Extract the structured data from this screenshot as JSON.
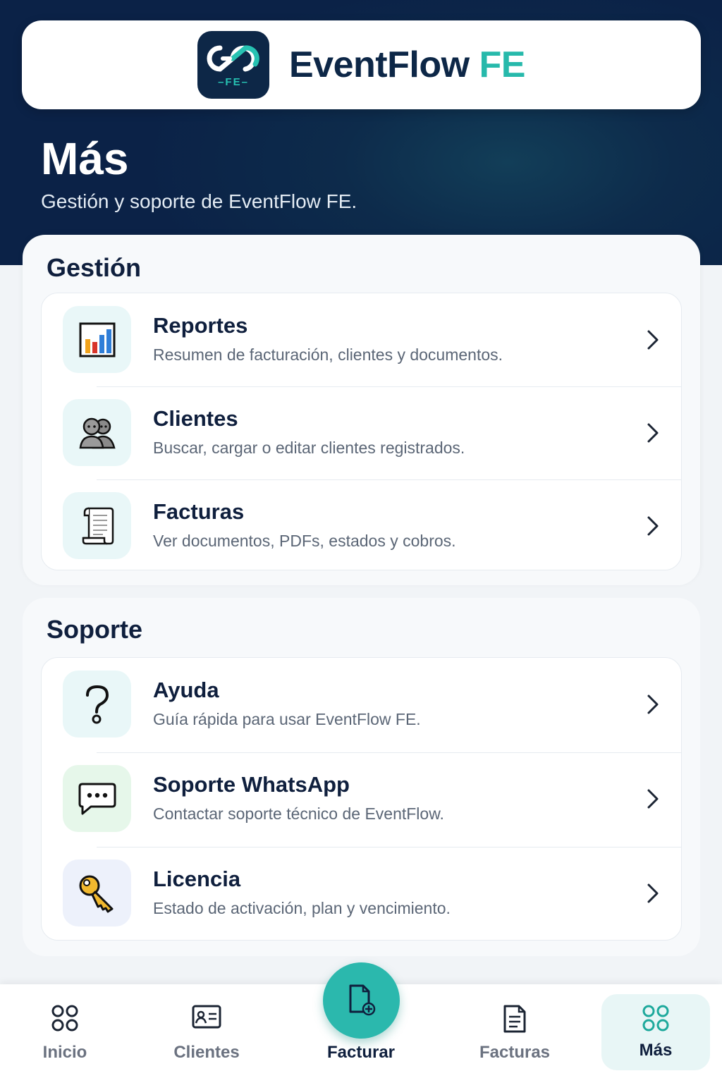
{
  "header": {
    "logo_badge": "FE",
    "brand_name": "EventFlow",
    "brand_accent": "FE"
  },
  "page": {
    "title": "Más",
    "subtitle": "Gestión y soporte de EventFlow FE."
  },
  "sections": {
    "gestion": {
      "title": "Gestión",
      "items": [
        {
          "icon": "bar-chart-icon",
          "title": "Reportes",
          "description": "Resumen de facturación, clientes y documentos."
        },
        {
          "icon": "people-icon",
          "title": "Clientes",
          "description": "Buscar, cargar o editar clientes registrados."
        },
        {
          "icon": "scroll-document-icon",
          "title": "Facturas",
          "description": "Ver documentos, PDFs, estados y cobros."
        }
      ]
    },
    "soporte": {
      "title": "Soporte",
      "items": [
        {
          "icon": "question-mark-icon",
          "title": "Ayuda",
          "description": "Guía rápida para usar EventFlow FE."
        },
        {
          "icon": "chat-bubble-icon",
          "title": "Soporte WhatsApp",
          "description": "Contactar soporte técnico de EventFlow."
        },
        {
          "icon": "key-icon",
          "title": "Licencia",
          "description": "Estado de activación, plan y vencimiento."
        }
      ]
    }
  },
  "tabbar": {
    "active": "Más",
    "items": [
      {
        "icon": "grid-icon",
        "label": "Inicio"
      },
      {
        "icon": "id-card-icon",
        "label": "Clientes"
      },
      {
        "icon": "new-document-icon",
        "label": "Facturar"
      },
      {
        "icon": "document-icon",
        "label": "Facturas"
      },
      {
        "icon": "grid-icon",
        "label": "Más"
      }
    ]
  },
  "colors": {
    "navy": "#0b2247",
    "teal_accent": "#27b9ab",
    "fab": "#2bb8ad"
  }
}
